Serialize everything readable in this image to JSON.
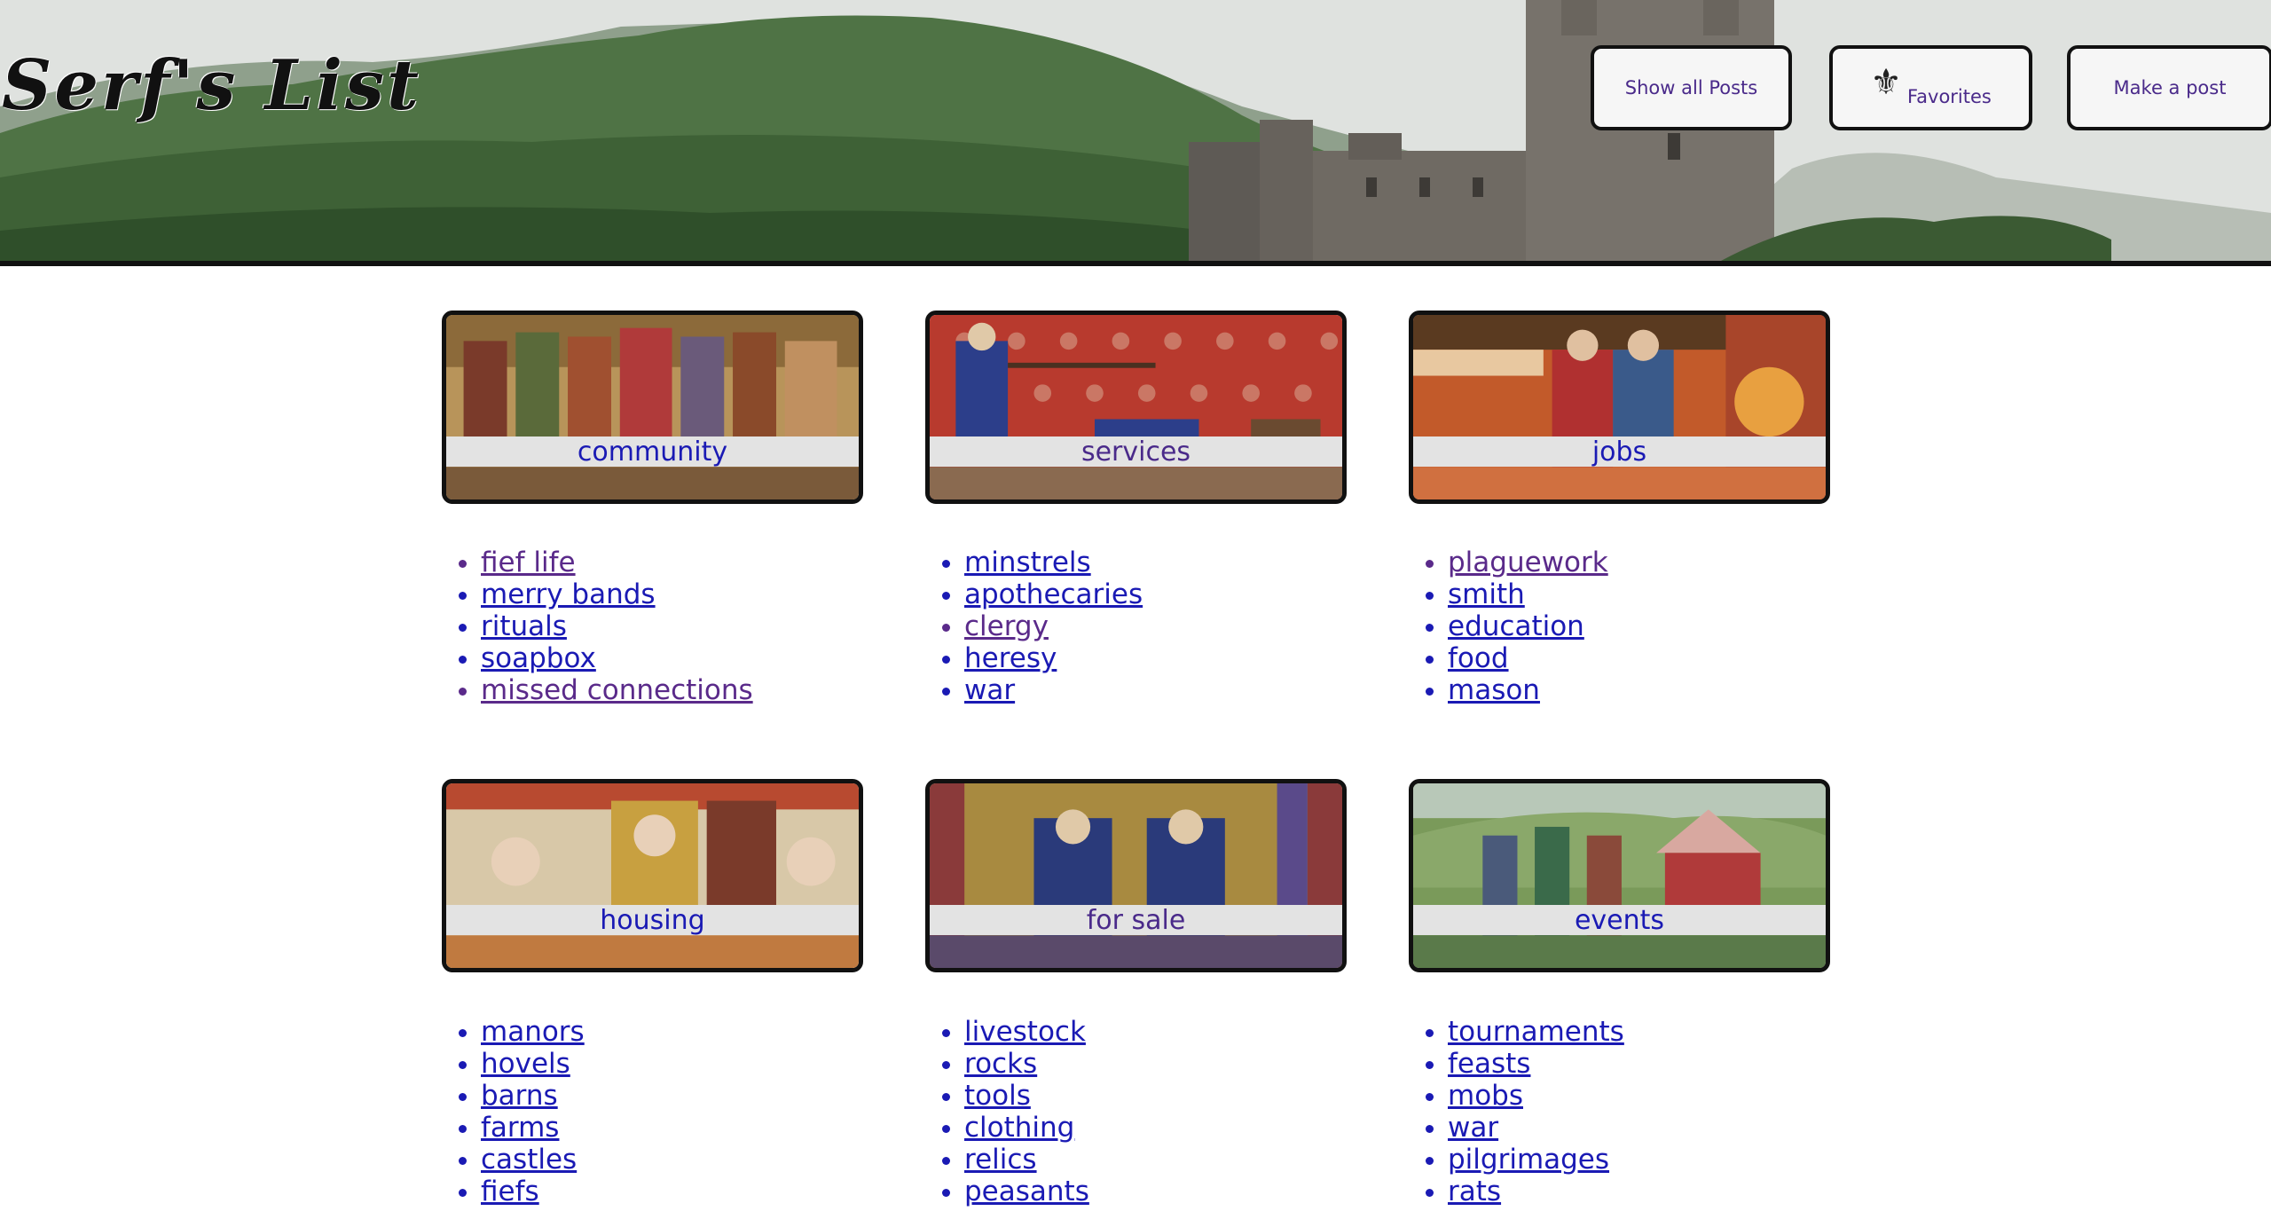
{
  "site": {
    "logo": "Serf's List"
  },
  "nav": {
    "show_all": "Show all Posts",
    "favorites": "Favorites",
    "make_post": "Make a post"
  },
  "categories": [
    {
      "label": "community",
      "visited": false,
      "links": [
        {
          "text": "fief life",
          "visited": true
        },
        {
          "text": "merry bands",
          "visited": false
        },
        {
          "text": "rituals",
          "visited": false
        },
        {
          "text": "soapbox",
          "visited": false
        },
        {
          "text": "missed connections",
          "visited": true
        }
      ]
    },
    {
      "label": "services",
      "visited": true,
      "links": [
        {
          "text": "minstrels",
          "visited": false
        },
        {
          "text": "apothecaries",
          "visited": false
        },
        {
          "text": "clergy",
          "visited": true
        },
        {
          "text": "heresy",
          "visited": false
        },
        {
          "text": "war",
          "visited": false
        }
      ]
    },
    {
      "label": "jobs",
      "visited": false,
      "links": [
        {
          "text": "plaguework",
          "visited": true
        },
        {
          "text": "smith",
          "visited": false
        },
        {
          "text": "education",
          "visited": false
        },
        {
          "text": "food",
          "visited": false
        },
        {
          "text": "mason",
          "visited": false
        }
      ]
    },
    {
      "label": "housing",
      "visited": false,
      "links": [
        {
          "text": "manors",
          "visited": false
        },
        {
          "text": "hovels",
          "visited": false
        },
        {
          "text": "barns",
          "visited": false
        },
        {
          "text": "farms",
          "visited": false
        },
        {
          "text": "castles",
          "visited": false
        },
        {
          "text": "fiefs",
          "visited": false
        }
      ]
    },
    {
      "label": "for sale",
      "visited": true,
      "links": [
        {
          "text": "livestock",
          "visited": false
        },
        {
          "text": "rocks",
          "visited": false
        },
        {
          "text": "tools",
          "visited": false
        },
        {
          "text": "clothing",
          "visited": false
        },
        {
          "text": "relics",
          "visited": false
        },
        {
          "text": "peasants",
          "visited": false
        }
      ]
    },
    {
      "label": "events",
      "visited": false,
      "links": [
        {
          "text": "tournaments",
          "visited": false
        },
        {
          "text": "feasts",
          "visited": false
        },
        {
          "text": "mobs",
          "visited": false
        },
        {
          "text": "war",
          "visited": false
        },
        {
          "text": "pilgrimages",
          "visited": false
        },
        {
          "text": "rats",
          "visited": false
        }
      ]
    }
  ],
  "colors": {
    "link": "#1a1ab4",
    "visited": "#5a2a8a",
    "border": "#111111",
    "label_bg": "#e3e3e3"
  },
  "icons": {
    "favorites": "fleur-de-lis-icon"
  }
}
